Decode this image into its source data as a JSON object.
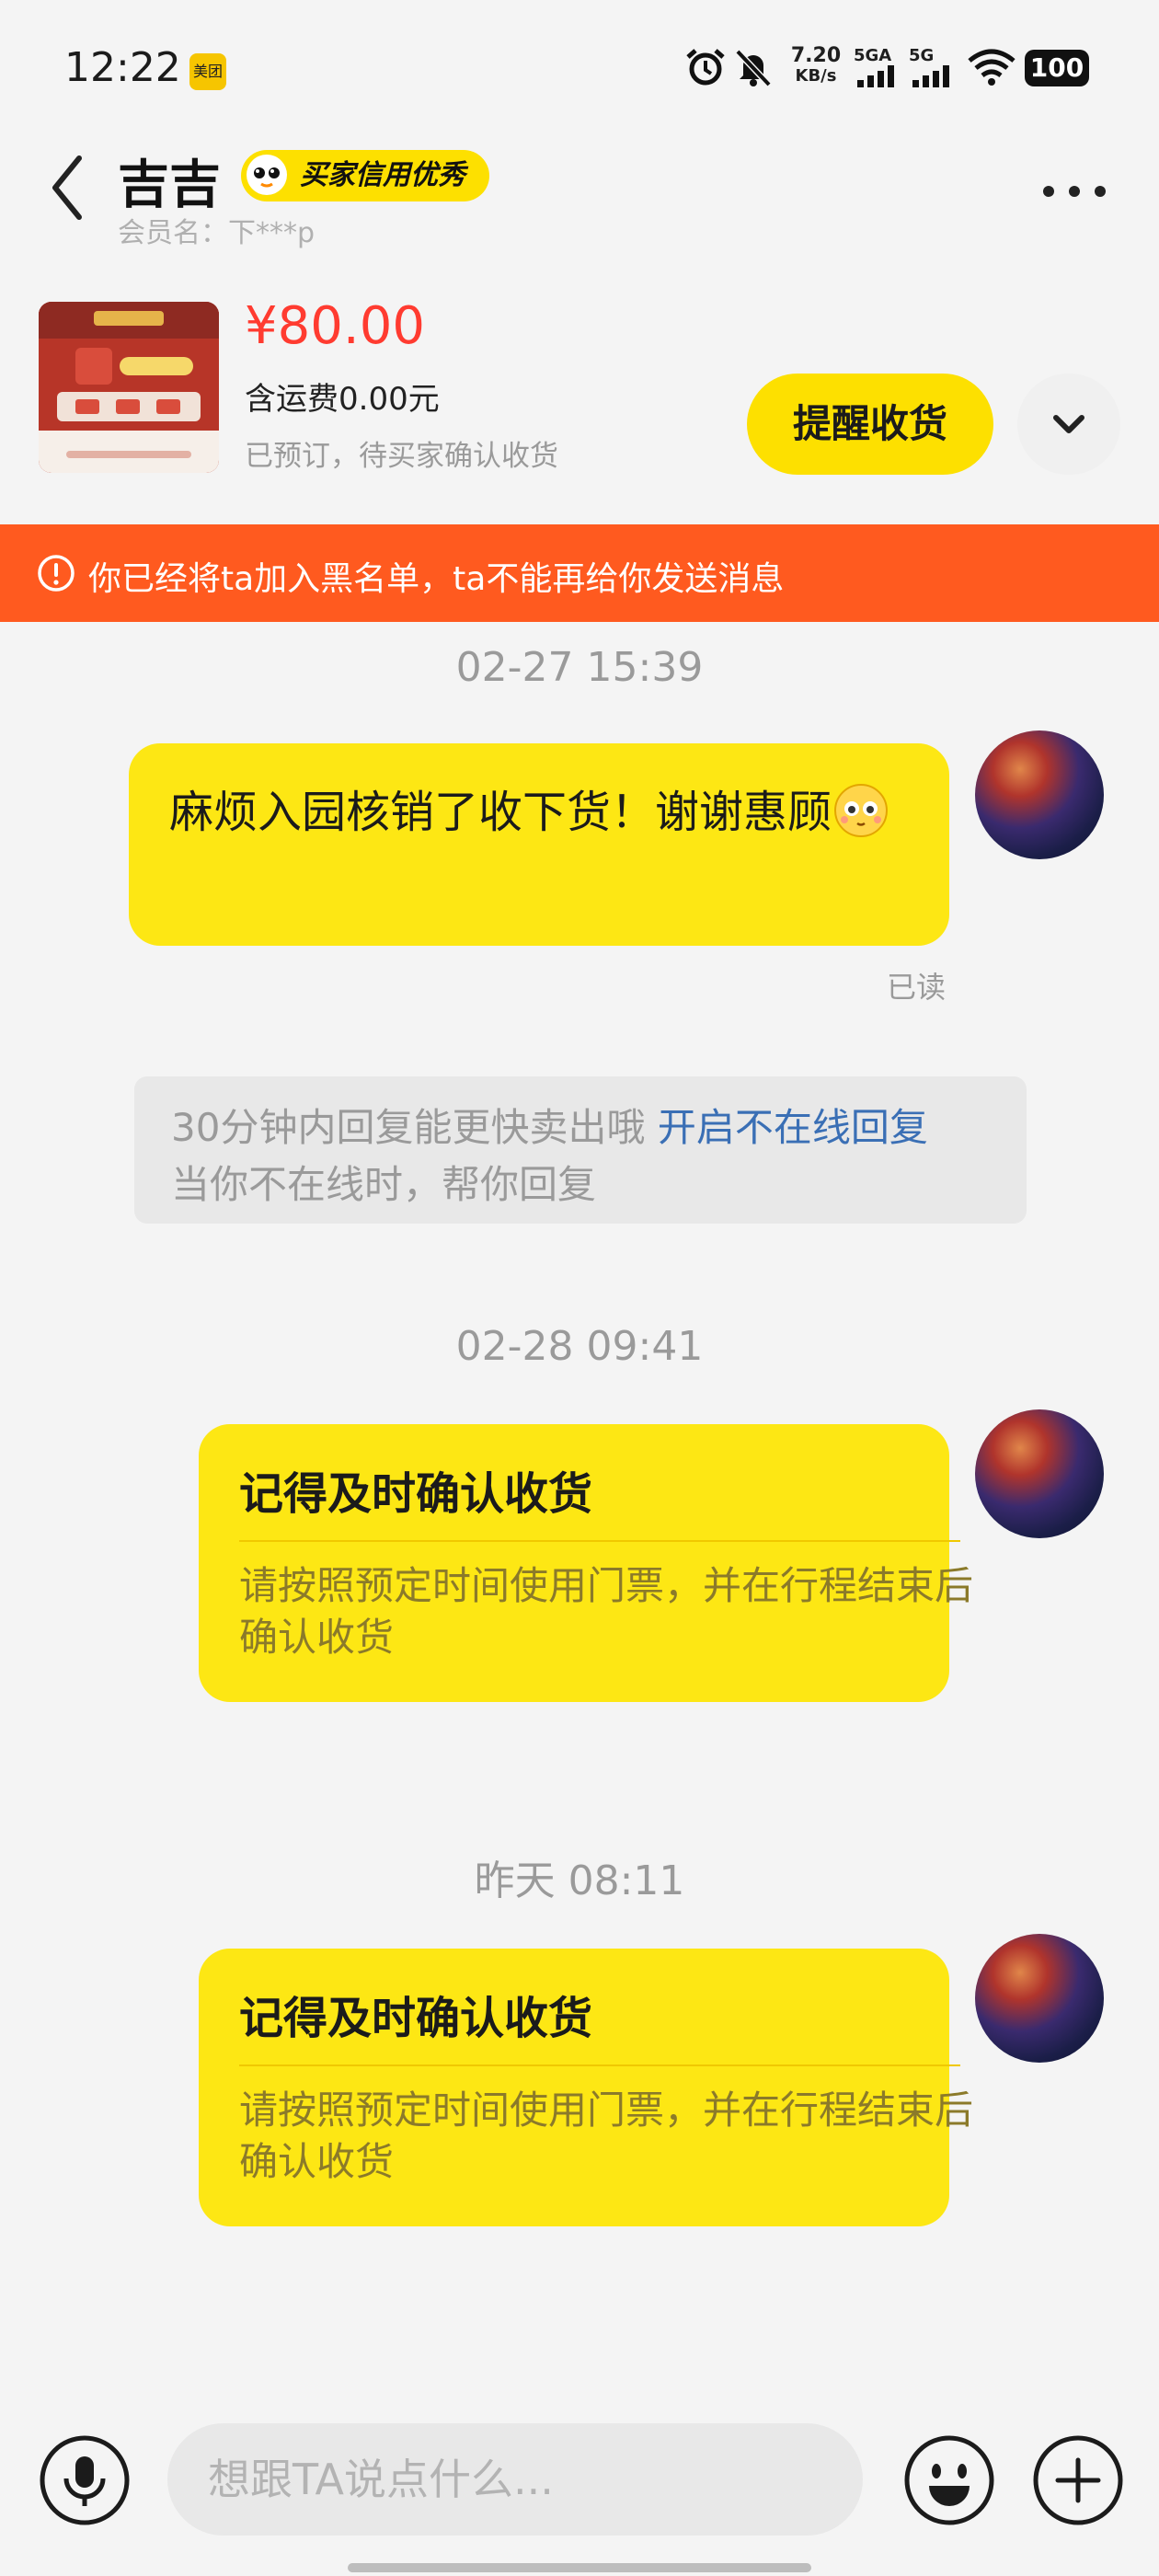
{
  "status_bar": {
    "time": "12:22",
    "app_badge": "美团",
    "speed_value": "7.20",
    "speed_unit": "KB/s",
    "signal1": "5GA",
    "signal2": "5G",
    "battery": "100"
  },
  "header": {
    "contact_name": "吉吉",
    "credit_badge": "买家信用优秀",
    "member_label": "会员名：下***p"
  },
  "product": {
    "price": "¥80.00",
    "shipping": "含运费0.00元",
    "status": "已预订，待买家确认收货",
    "remind_button": "提醒收货"
  },
  "banner": {
    "text": "你已经将ta加入黑名单，ta不能再给你发送消息"
  },
  "messages": [
    {
      "timestamp": "02-27 15:39",
      "text": "麻烦入园核销了收下货！谢谢惠顾",
      "read": "已读"
    },
    {
      "timestamp": "02-28 09:41",
      "card_title": "记得及时确认收货",
      "card_body": "请按照预定时间使用门票，并在行程结束后确认收货"
    },
    {
      "timestamp": "昨天 08:11",
      "card_title": "记得及时确认收货",
      "card_body": "请按照预定时间使用门票，并在行程结束后确认收货"
    }
  ],
  "tip": {
    "line1": "30分钟内回复能更快卖出哦",
    "link": "开启不在线回复",
    "line2": "当你不在线时，帮你回复"
  },
  "input": {
    "placeholder": "想跟TA说点什么..."
  },
  "colors": {
    "accent_yellow": "#fde714",
    "banner_orange": "#ff5a1f",
    "price_red": "#ff3b30",
    "link_blue": "#3a6fb5"
  }
}
